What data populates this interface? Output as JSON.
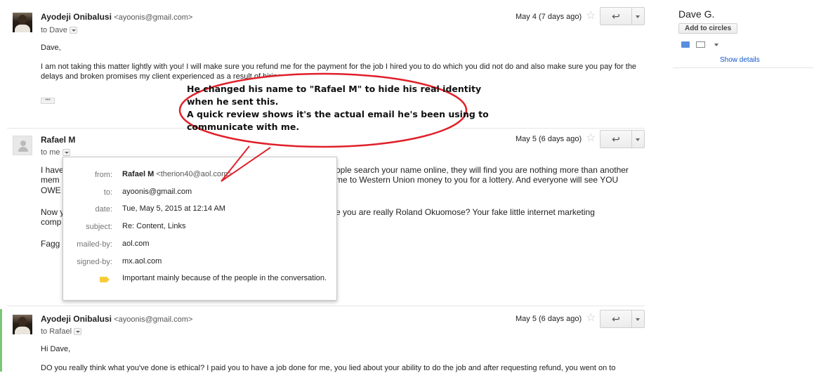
{
  "messages": [
    {
      "sender_name": "Ayodeji Onibalusi",
      "sender_email": "<ayoonis@gmail.com>",
      "to": "to Dave",
      "date": "May 4 (7 days ago)",
      "body": [
        "Dave,",
        "I am not taking this matter lightly with you! I will make sure you refund me for the payment for the job I hired you to do which you did not do and also make sure you pay for the",
        "delays and broken promises my client experienced as a result of hiring you!"
      ]
    },
    {
      "sender_name": "Rafael M",
      "to": "to me",
      "date": "May 5 (6 days ago)",
      "body": [
        "I have",
        "mem",
        "OWE",
        "Now y",
        "comp",
        "Fagg",
        "ople search your name online, they will find you are nothing more than another",
        "me to Western Union money to you for a lottery.  And everyone will see YOU",
        "e you are really Roland Okuomose?  Your fake little internet marketing"
      ]
    },
    {
      "sender_name": "Ayodeji Onibalusi",
      "sender_email": "<ayoonis@gmail.com>",
      "to": "to Rafael",
      "date": "May 5 (6 days ago)",
      "body": [
        "Hi Dave,",
        "DO you really think what you've done is ethical? I paid you to have a job done for me, you lied about your ability to do the job and after requesting refund, you went on to"
      ]
    }
  ],
  "details_popup": {
    "from_label": "from:",
    "from_name": "Rafael M",
    "from_email": "<therion40@aol.com>",
    "to_label": "to:",
    "to_value": "ayoonis@gmail.com",
    "date_label": "date:",
    "date_value": "Tue, May 5, 2015 at 12:14 AM",
    "subject_label": "subject:",
    "subject_value": "Re: Content, Links",
    "mailedby_label": "mailed-by:",
    "mailedby_value": "aol.com",
    "signedby_label": "signed-by:",
    "signedby_value": "mx.aol.com",
    "importance_value": "Important mainly because of the people in the conversation."
  },
  "annotation": {
    "lines": [
      "He changed his name to \"Rafael M\" to hide his real identity",
      "when he sent this.",
      "A quick review shows it's the actual email he's been using to",
      "communicate with me."
    ],
    "color": "#e0202a"
  },
  "contact_panel": {
    "name": "Dave G.",
    "add_to_circles": "Add to circles",
    "show_details": "Show details"
  },
  "colors": {
    "link": "#1155cc",
    "label_important": "#f7cc38"
  }
}
